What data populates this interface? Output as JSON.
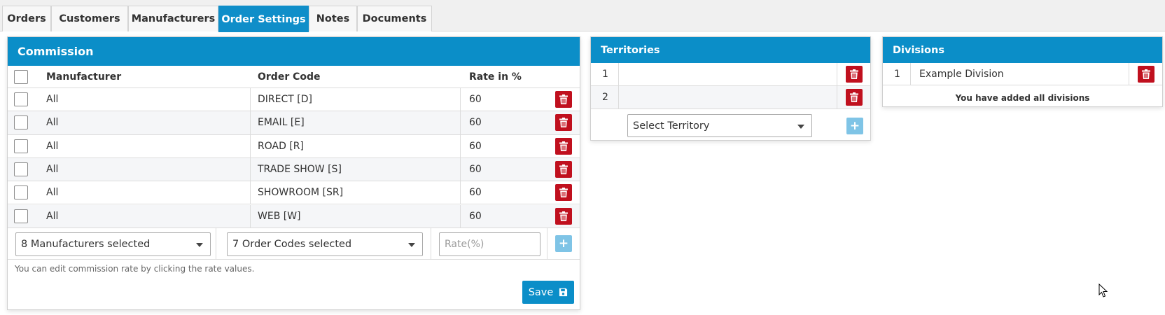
{
  "tabs": [
    {
      "label": "Orders"
    },
    {
      "label": "Customers"
    },
    {
      "label": "Manufacturers"
    },
    {
      "label": "Order Settings",
      "active": true
    },
    {
      "label": "Notes"
    },
    {
      "label": "Documents"
    }
  ],
  "commission": {
    "title": "Commission",
    "headers": {
      "manufacturer": "Manufacturer",
      "order_code": "Order Code",
      "rate": "Rate in %"
    },
    "rows": [
      {
        "manufacturer": "All",
        "order_code": "DIRECT [D]",
        "rate": "60"
      },
      {
        "manufacturer": "All",
        "order_code": "EMAIL [E]",
        "rate": "60"
      },
      {
        "manufacturer": "All",
        "order_code": "ROAD [R]",
        "rate": "60"
      },
      {
        "manufacturer": "All",
        "order_code": "TRADE SHOW [S]",
        "rate": "60"
      },
      {
        "manufacturer": "All",
        "order_code": "SHOWROOM [SR]",
        "rate": "60"
      },
      {
        "manufacturer": "All",
        "order_code": "WEB [W]",
        "rate": "60"
      }
    ],
    "manufacturers_select": "8 Manufacturers selected",
    "order_codes_select": "7 Order Codes selected",
    "rate_placeholder": "Rate(%)",
    "hint": "You can edit commission rate by clicking the rate values.",
    "save_label": "Save"
  },
  "territories": {
    "title": "Territories",
    "rows": [
      {
        "num": "1",
        "name": ""
      },
      {
        "num": "2",
        "name": ""
      }
    ],
    "select_label": "Select Territory"
  },
  "divisions": {
    "title": "Divisions",
    "rows": [
      {
        "num": "1",
        "name": "Example Division"
      }
    ],
    "note": "You have added all divisions"
  },
  "colors": {
    "accent": "#0b8ec8",
    "delete": "#c0101e",
    "add_disabled": "#7fc4e6"
  }
}
